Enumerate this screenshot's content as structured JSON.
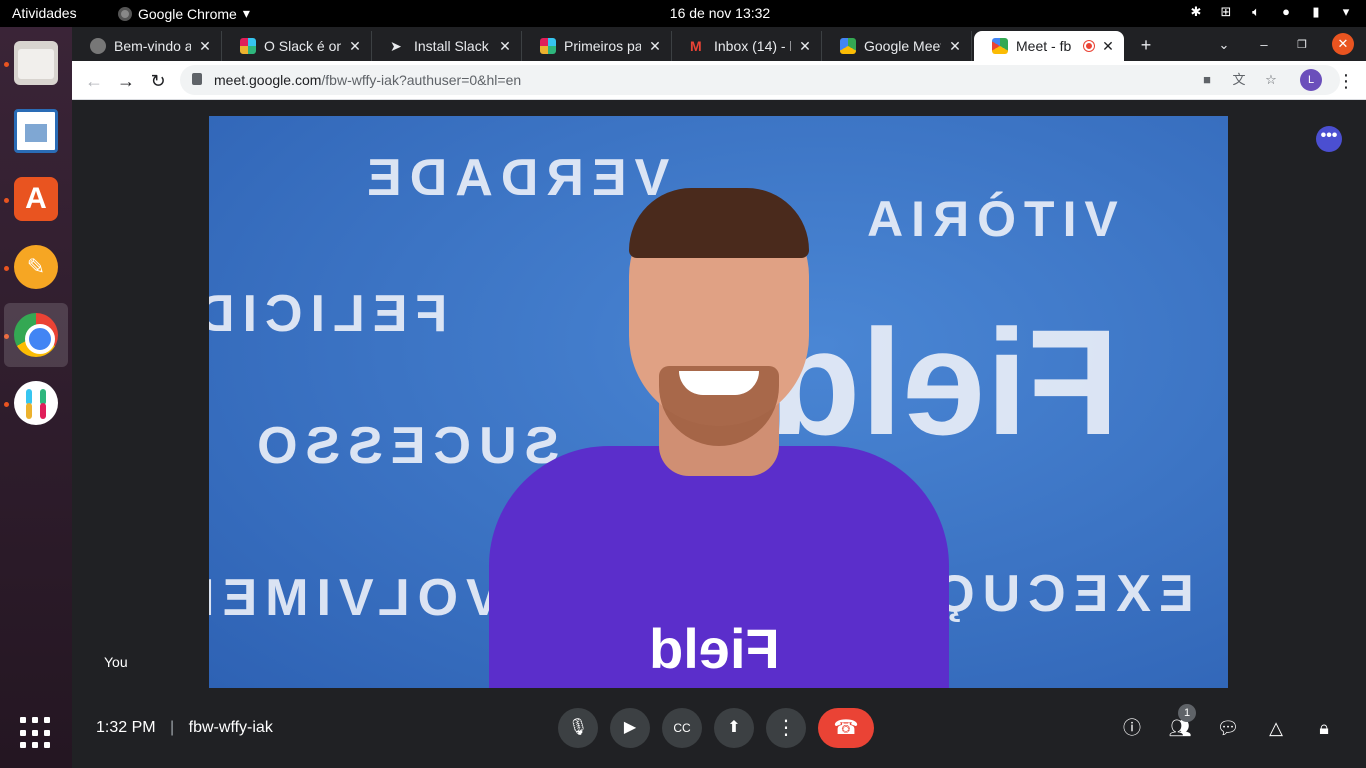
{
  "topbar": {
    "activities": "Atividades",
    "app_name": "Google Chrome",
    "clock": "16 de nov  13:32"
  },
  "tabs": [
    {
      "label": "Bem-vindo a",
      "icon": "globe-icon"
    },
    {
      "label": "O Slack é on",
      "icon": "slack-icon"
    },
    {
      "label": "Install Slack",
      "icon": "arrow-icon"
    },
    {
      "label": "Primeiros pa",
      "icon": "slack-icon"
    },
    {
      "label": "Inbox (14) - l",
      "icon": "gmail-icon"
    },
    {
      "label": "Google Meet",
      "icon": "meet-icon"
    },
    {
      "label": "Meet - fb",
      "icon": "meet-icon",
      "active": true
    }
  ],
  "omnibox": {
    "domain": "meet.google.com",
    "path": "/fbw-wffy-iak?authuser=0&hl=en"
  },
  "profile_initial": "L",
  "video": {
    "wall_words": [
      "VERDADE",
      "VITÒRIA",
      "FELICID",
      "SUCESSO",
      "VOLVIMEN",
      "EXECUÇ",
      "Field"
    ],
    "shirt_text": "Field",
    "bg_color": "#3a74c8",
    "shirt_color": "#5b2ecb"
  },
  "you_label": "You",
  "meeting": {
    "time": "1:32 PM",
    "code": "fbw-wffy-iak",
    "participants_count": "1"
  },
  "colors": {
    "end_call": "#ea4335",
    "accent_purple": "#4b4fd1"
  }
}
